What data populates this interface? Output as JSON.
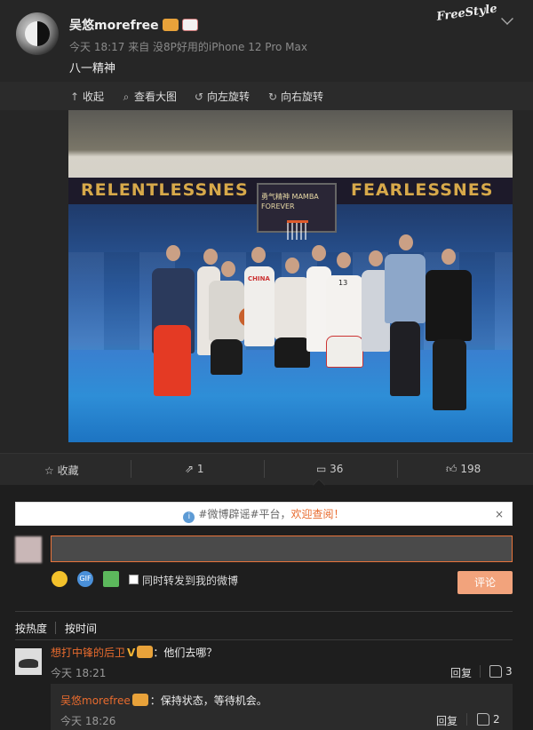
{
  "post": {
    "username": "吴悠morefree",
    "meta": "今天 18:17 来自 没8P好用的iPhone 12 Pro Max",
    "text": "八一精神",
    "logo_text": "FreeStyle"
  },
  "media_toolbar": {
    "collapse": "收起",
    "view_large": "查看大图",
    "rotate_left": "向左旋转",
    "rotate_right": "向右旋转"
  },
  "photo": {
    "banner_left": "RELENTLESSNES",
    "banner_right": "FEARLESSNES",
    "board_text": "勇气精神 MAMBA FOREVER",
    "jersey_text": "CHINA",
    "jersey_number": "13"
  },
  "actions": {
    "favorite": "收藏",
    "repost_count": "1",
    "comment_count": "36",
    "like_count": "198"
  },
  "notice": {
    "prefix": "#微博辟谣#平台，",
    "highlight": "欢迎查阅！",
    "close": "×"
  },
  "composer": {
    "input_value": "",
    "gif_label": "GIF",
    "repost_checkbox_label": "同时转发到我的微博",
    "submit_label": "评论"
  },
  "sort": {
    "by_hot": "按热度",
    "by_time": "按时间"
  },
  "comments": [
    {
      "name": "想打中锋的后卫",
      "text": "：他们去哪？",
      "time": "今天 18:21",
      "reply": "回复",
      "likes": "3",
      "replies": [
        {
          "name": "吴悠morefree",
          "text": "：保持状态，等待机会。",
          "time": "今天 18:26",
          "reply": "回复",
          "likes": "2"
        }
      ]
    }
  ],
  "icons": {
    "collapse": "arrow-up-icon",
    "view_large": "search-icon",
    "rotate_left": "rotate-left-icon",
    "rotate_right": "rotate-right-icon",
    "favorite": "star-icon",
    "repost": "share-icon",
    "comment": "comment-icon",
    "like": "thumb-up-icon",
    "info": "info-icon",
    "emoji": "emoji-icon",
    "gif": "gif-icon",
    "image": "image-icon"
  },
  "colors": {
    "accent": "#e86b2e",
    "submit_bg": "#f2a37c",
    "background": "#262626"
  }
}
